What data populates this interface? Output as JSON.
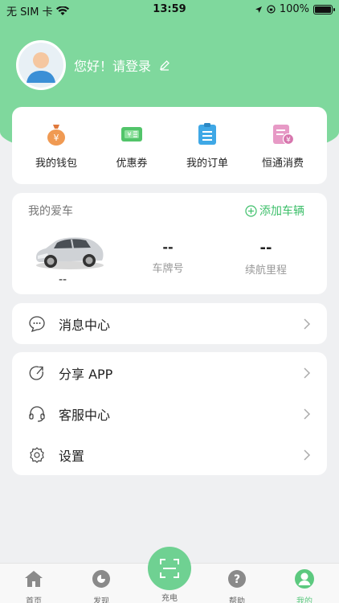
{
  "status_bar": {
    "carrier": "无 SIM 卡",
    "time": "13:59",
    "battery": "100%"
  },
  "profile": {
    "greeting": "您好！请登录"
  },
  "quick_actions": [
    {
      "label": "我的钱包",
      "icon": "money-bag-icon"
    },
    {
      "label": "优惠券",
      "icon": "coupon-icon"
    },
    {
      "label": "我的订单",
      "icon": "order-clipboard-icon"
    },
    {
      "label": "恒通消费",
      "icon": "consumption-receipt-icon"
    }
  ],
  "car": {
    "title": "我的爱车",
    "add_label": "添加车辆",
    "car_name": "--",
    "plate_value": "--",
    "plate_label": "车牌号",
    "range_value": "--",
    "range_label": "续航里程"
  },
  "menu_single": [
    {
      "label": "消息中心",
      "icon": "chat-bubble-icon"
    }
  ],
  "menu_group": [
    {
      "label": "分享 APP",
      "icon": "share-icon"
    },
    {
      "label": "客服中心",
      "icon": "headset-icon"
    },
    {
      "label": "设置",
      "icon": "gear-icon"
    }
  ],
  "tabbar": {
    "home": "首页",
    "discover": "发现",
    "charge": "充电",
    "help": "帮助",
    "mine": "我的"
  },
  "colors": {
    "brand_green": "#7fd89d",
    "accent_green": "#3dbf6a",
    "active_tab": "#5cc97f"
  }
}
